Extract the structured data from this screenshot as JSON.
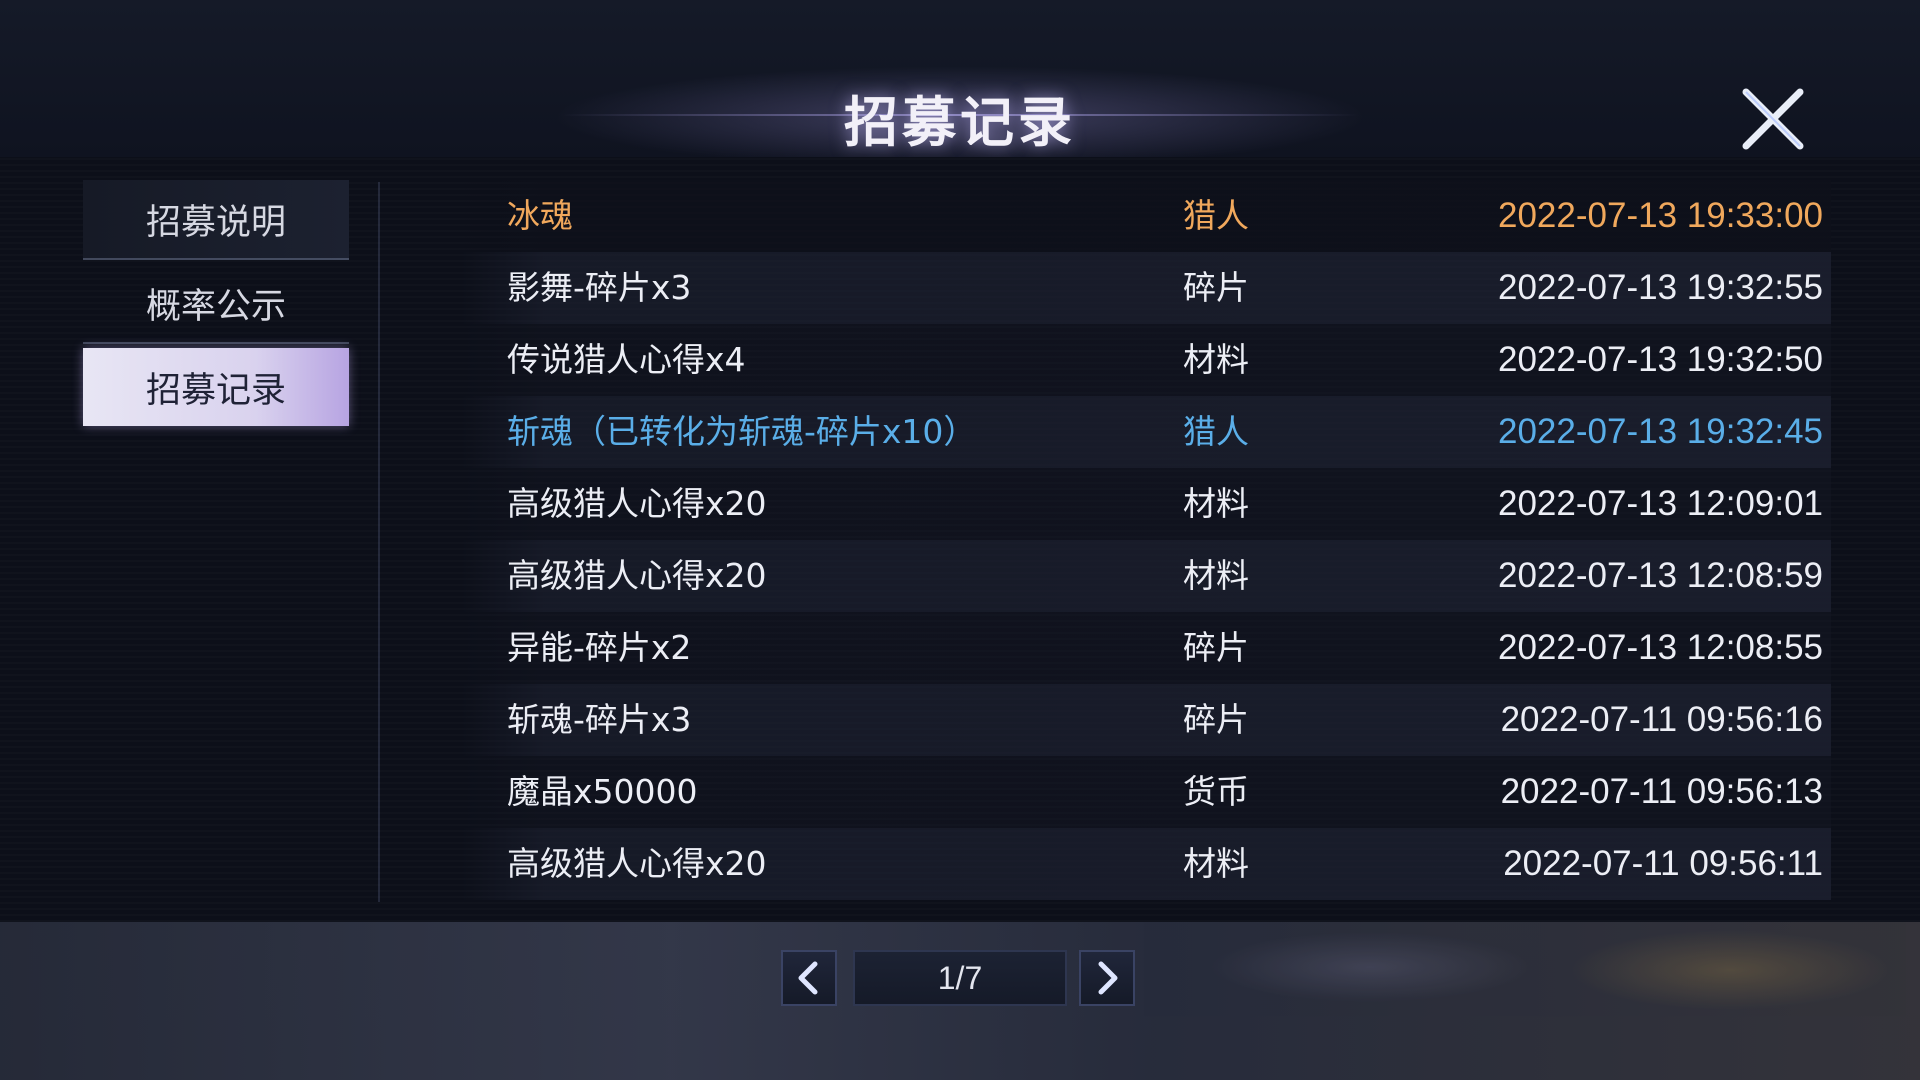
{
  "header": {
    "title": "招募记录"
  },
  "sidebar": {
    "tabs": [
      {
        "label": "招募说明",
        "selected": false
      },
      {
        "label": "概率公示",
        "selected": false
      },
      {
        "label": "招募记录",
        "selected": true
      }
    ]
  },
  "records": [
    {
      "item": "冰魂",
      "type": "猎人",
      "time": "2022-07-13 19:33:00",
      "highlight": "gold"
    },
    {
      "item": "影舞-碎片x3",
      "type": "碎片",
      "time": "2022-07-13 19:32:55",
      "highlight": "none"
    },
    {
      "item": "传说猎人心得x4",
      "type": "材料",
      "time": "2022-07-13 19:32:50",
      "highlight": "none"
    },
    {
      "item": "斩魂（已转化为斩魂-碎片x10）",
      "type": "猎人",
      "time": "2022-07-13 19:32:45",
      "highlight": "blue"
    },
    {
      "item": "高级猎人心得x20",
      "type": "材料",
      "time": "2022-07-13 12:09:01",
      "highlight": "none"
    },
    {
      "item": "高级猎人心得x20",
      "type": "材料",
      "time": "2022-07-13 12:08:59",
      "highlight": "none"
    },
    {
      "item": "异能-碎片x2",
      "type": "碎片",
      "time": "2022-07-13 12:08:55",
      "highlight": "none"
    },
    {
      "item": "斩魂-碎片x3",
      "type": "碎片",
      "time": "2022-07-11 09:56:16",
      "highlight": "none"
    },
    {
      "item": "魔晶x50000",
      "type": "货币",
      "time": "2022-07-11 09:56:13",
      "highlight": "none"
    },
    {
      "item": "高级猎人心得x20",
      "type": "材料",
      "time": "2022-07-11 09:56:11",
      "highlight": "none"
    }
  ],
  "pager": {
    "page_label": "1/7",
    "current": 1,
    "total": 7
  },
  "icons": {
    "close": "close-icon",
    "prev": "chevron-left-icon",
    "next": "chevron-right-icon"
  },
  "colors": {
    "gold_highlight": "#f0a85c",
    "blue_highlight": "#5aaee8",
    "text": "#eceef5",
    "selected_tab": "#e8e6f4"
  }
}
